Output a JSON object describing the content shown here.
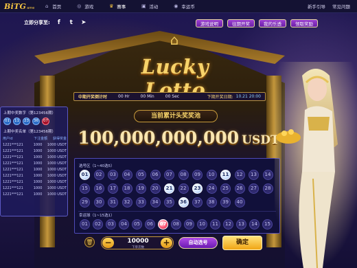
{
  "nav": {
    "logo_main": "BiTG",
    "logo_sub": "ame",
    "items": [
      {
        "label": "首页",
        "icon": "home-icon",
        "glyph": "⌂",
        "active": false
      },
      {
        "label": "游戏",
        "icon": "gamepad-icon",
        "glyph": "◎",
        "active": false
      },
      {
        "label": "赛事",
        "icon": "trophy-icon",
        "glyph": "♛",
        "active": true
      },
      {
        "label": "活动",
        "icon": "gift-icon",
        "glyph": "▣",
        "active": false
      },
      {
        "label": "幸运币",
        "icon": "coin-icon",
        "glyph": "◉",
        "active": false
      }
    ],
    "right": [
      "新手引导",
      "常见问题"
    ]
  },
  "share": {
    "label": "立即分享至:",
    "icons": [
      {
        "name": "facebook-icon",
        "glyph": "f"
      },
      {
        "name": "twitter-icon",
        "glyph": "t"
      },
      {
        "name": "telegram-icon",
        "glyph": "➤"
      }
    ]
  },
  "quick_buttons": [
    "游戏说明",
    "往期开奖",
    "我的乐透",
    "领取奖励"
  ],
  "game_title": "Lucky Lotto",
  "timer": {
    "label": "中期开奖倒计时",
    "hr": "00 Hr",
    "min": "00 Min",
    "sec": "00 Sec",
    "next_label": "下期开奖日期:",
    "next_value": "10.21 20:00"
  },
  "jackpot": {
    "label": "当前累计头奖奖池",
    "amount": "100,000,000,000",
    "unit": "USDT"
  },
  "left_panel": {
    "latest_title": "上期中奖数字（第123456期）",
    "latest_balls": [
      "01",
      "11",
      "23",
      "36",
      "07"
    ],
    "red_index": 4,
    "winners_title": "上期中奖名单（第123456期）",
    "headers": [
      "用户id",
      "下注金额",
      "获得奖金"
    ],
    "rows": [
      [
        "1221***121",
        "1000",
        "1000 USDT"
      ],
      [
        "1221***121",
        "1000",
        "1000 USDT"
      ],
      [
        "1221***121",
        "1000",
        "1000 USDT"
      ],
      [
        "1221***121",
        "1000",
        "1000 USDT"
      ],
      [
        "1221***121",
        "1000",
        "1000 USDT"
      ],
      [
        "1221***121",
        "1000",
        "1000 USDT"
      ],
      [
        "1221***121",
        "1000",
        "1000 USDT"
      ],
      [
        "1221***121",
        "1000",
        "1000 USDT"
      ],
      [
        "1221***121",
        "1000",
        "1000 USDT"
      ]
    ]
  },
  "board": {
    "pick_label": "选号区（1~40选5）",
    "pick_numbers": [
      "01",
      "02",
      "03",
      "04",
      "05",
      "06",
      "07",
      "08",
      "09",
      "10",
      "11",
      "12",
      "13",
      "14",
      "15",
      "16",
      "17",
      "18",
      "19",
      "20",
      "21",
      "22",
      "23",
      "24",
      "25",
      "26",
      "27",
      "28",
      "29",
      "30",
      "31",
      "32",
      "33",
      "34",
      "35",
      "36",
      "37",
      "38",
      "39",
      "40"
    ],
    "pick_selected": [
      "01",
      "11",
      "21",
      "23",
      "36"
    ],
    "lucky_label": "幸运球（1~15选1）",
    "lucky_numbers": [
      "01",
      "02",
      "03",
      "04",
      "05",
      "06",
      "07",
      "08",
      "09",
      "10",
      "11",
      "12",
      "13",
      "14",
      "15"
    ],
    "lucky_selected": [
      "07"
    ]
  },
  "controls": {
    "stake": "10000",
    "stake_sub": "下单次数",
    "minus": "−",
    "plus": "+",
    "auto_label": "自动选号",
    "ok_label": "确定"
  },
  "colors": {
    "gold": "#f5c542",
    "blue_ball": "#2b6cc7",
    "red_ball": "#b01430",
    "board_bg": "#11103a"
  }
}
